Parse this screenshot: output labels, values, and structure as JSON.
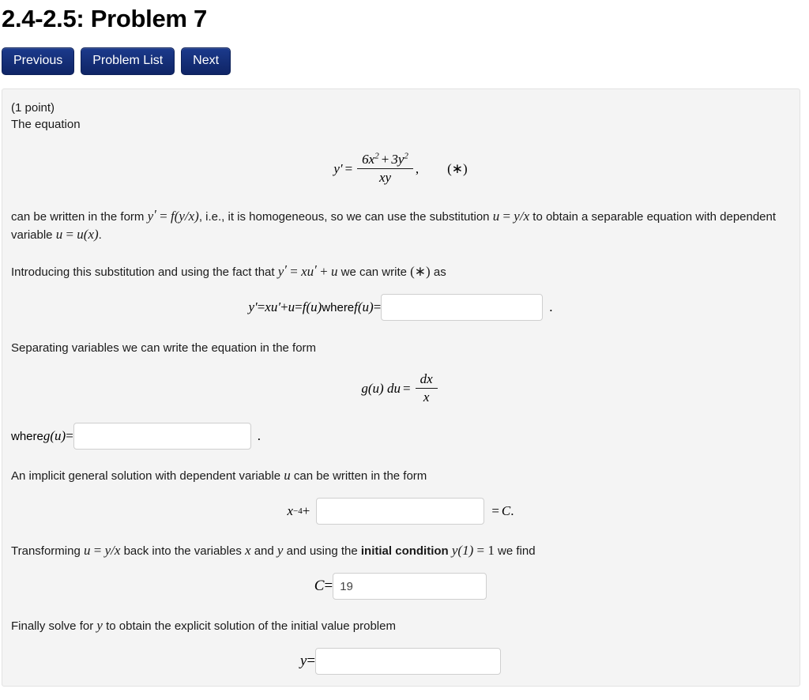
{
  "header": {
    "title": "2.4-2.5: Problem 7"
  },
  "nav": {
    "previous_label": "Previous",
    "problem_list_label": "Problem List",
    "next_label": "Next"
  },
  "problem": {
    "points": "(1 point)",
    "lead": "The equation",
    "main_equation": {
      "lhs": "y",
      "prime": "′",
      "equals": "=",
      "numerator_a": "6x",
      "numerator_a_exp": "2",
      "plus": "+",
      "numerator_b": "3y",
      "numerator_b_exp": "2",
      "denominator": "xy",
      "comma": ",",
      "star_tag": "(∗)"
    },
    "para_homogeneous": {
      "t1": "can be written in the form ",
      "m1": "y",
      "m1p": "′",
      "t2": " = ",
      "m2": "f(y/x)",
      "t3": ", i.e., it is homogeneous, so we can use the substitution ",
      "m4": "u",
      "t4": " = ",
      "m5": "y/x",
      "t5": " to obtain a separable equation with dependent variable ",
      "m6": "u",
      "t6": " = ",
      "m7": "u(x)",
      "t7": "."
    },
    "para_introducing": {
      "t1": "Introducing this substitution and using the fact that ",
      "m1": "y",
      "m1p": "′",
      "t2": " = ",
      "m2": "xu",
      "m2p": "′",
      "t3": " + ",
      "m3": "u",
      "t4": " we can write ",
      "m4": "(∗)",
      "t5": " as"
    },
    "eq_fu": {
      "lhs": "y",
      "lhs_prime": "′",
      "eq1": " = ",
      "xu": "xu",
      "xu_prime": "′",
      "plus": " + ",
      "u": "u",
      "eq2": " = ",
      "fu": "f(u)",
      "where": " where ",
      "fu2": "f(u)",
      "eq3": " = ",
      "input_value": "",
      "input_placeholder": "",
      "trailing": "."
    },
    "para_separating": "Separating variables we can write the equation in the form",
    "eq_separable": {
      "gu_du": "g(u) du",
      "equals": "=",
      "num": "dx",
      "den": "x"
    },
    "eq_gu": {
      "where": "where ",
      "gu": "g(u)",
      "equals": " = ",
      "input_value": "",
      "input_placeholder": "",
      "trailing": "."
    },
    "para_implicit": {
      "t1": "An implicit general solution with dependent variable ",
      "m1": "u",
      "t2": " can be written in the form"
    },
    "eq_implicit": {
      "x_term": "x",
      "x_exp": "−4",
      "plus": "+",
      "input_value": "",
      "input_placeholder": "",
      "equals": "=",
      "C": "C",
      "trailing": "."
    },
    "para_transform": {
      "t1": "Transforming ",
      "m1": "u",
      "t2": " = ",
      "m2": "y/x",
      "t3": " back into the variables ",
      "m3": "x",
      "t4": " and ",
      "m4": "y",
      "t5": " and using the ",
      "bold": "initial condition",
      "t6": " ",
      "m5": "y(1)",
      "t7": " = ",
      "m6": "1",
      "t8": " we find"
    },
    "eq_C": {
      "label": "C",
      "equals": " = ",
      "input_value": "19",
      "input_placeholder": ""
    },
    "para_finally": {
      "t1": "Finally solve for ",
      "m1": "y",
      "t2": " to obtain the explicit solution of the initial value problem"
    },
    "eq_y": {
      "label": "y",
      "equals": " = ",
      "input_value": "",
      "input_placeholder": ""
    }
  },
  "colors": {
    "button_blue": "#16307a",
    "panel_bg": "#f4f4f4",
    "panel_border": "#e2e2e2",
    "input_border": "#cfcfcf"
  }
}
